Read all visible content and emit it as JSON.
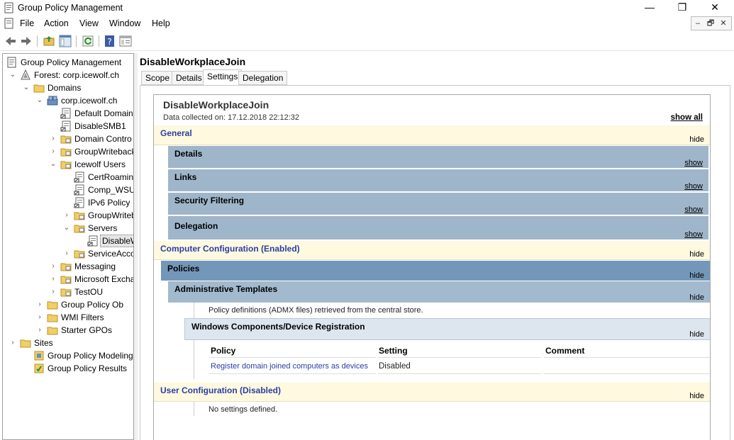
{
  "window": {
    "title": "Group Policy Management",
    "minimize": "—",
    "maximize": "❐",
    "close": "✕"
  },
  "menu": [
    "File",
    "Action",
    "View",
    "Window",
    "Help"
  ],
  "mdi_buttons": [
    "–",
    "🗗",
    "✕"
  ],
  "tree": [
    {
      "label": "Group Policy Management",
      "expander": "",
      "icon": "gpm-icon"
    },
    {
      "label": "Forest: corp.icewolf.ch",
      "expander": "⌄",
      "icon": "forest-icon"
    },
    {
      "label": "Domains",
      "expander": "⌄",
      "icon": "folder-icon"
    },
    {
      "label": "corp.icewolf.ch",
      "expander": "⌄",
      "icon": "domain-icon"
    },
    {
      "label": "Default Domain",
      "expander": "",
      "icon": "gpo-link-icon"
    },
    {
      "label": "DisableSMB1",
      "expander": "",
      "icon": "gpo-link-icon"
    },
    {
      "label": "Domain Contro",
      "expander": "›",
      "icon": "ou-icon"
    },
    {
      "label": "GroupWriteback",
      "expander": "›",
      "icon": "ou-icon"
    },
    {
      "label": "Icewolf Users",
      "expander": "⌄",
      "icon": "ou-icon"
    },
    {
      "label": "CertRoamin",
      "expander": "",
      "icon": "gpo-link-icon"
    },
    {
      "label": "Comp_WSU",
      "expander": "",
      "icon": "gpo-link-icon"
    },
    {
      "label": "IPv6 Policy",
      "expander": "",
      "icon": "gpo-link-icon"
    },
    {
      "label": "GroupWriteb",
      "expander": "›",
      "icon": "ou-icon"
    },
    {
      "label": "Servers",
      "expander": "⌄",
      "icon": "ou-icon"
    },
    {
      "label": "DisableW",
      "expander": "",
      "icon": "gpo-link-icon"
    },
    {
      "label": "ServiceAcco",
      "expander": "›",
      "icon": "ou-icon"
    },
    {
      "label": "Messaging",
      "expander": "›",
      "icon": "ou-icon"
    },
    {
      "label": "Microsoft Excha",
      "expander": "›",
      "icon": "ou-icon"
    },
    {
      "label": "TestOU",
      "expander": "›",
      "icon": "ou-icon"
    },
    {
      "label": "Group Policy Ob",
      "expander": "›",
      "icon": "folder-icon"
    },
    {
      "label": "WMI Filters",
      "expander": "›",
      "icon": "folder-icon"
    },
    {
      "label": "Starter GPOs",
      "expander": "›",
      "icon": "folder-icon"
    },
    {
      "label": "Sites",
      "expander": "›",
      "icon": "folder-icon"
    },
    {
      "label": "Group Policy Modeling",
      "expander": "",
      "icon": "modeling-icon"
    },
    {
      "label": "Group Policy Results",
      "expander": "",
      "icon": "results-icon"
    }
  ],
  "right": {
    "title": "DisableWorkplaceJoin",
    "tabs": [
      "Scope",
      "Details",
      "Settings",
      "Delegation"
    ],
    "active_tab": "Settings"
  },
  "report": {
    "title": "DisableWorkplaceJoin",
    "collected": "Data collected on: 17.12.2018 22:12:32",
    "show_all": "show all",
    "general": {
      "title": "General",
      "link": "hide"
    },
    "details": {
      "title": "Details",
      "link": "show"
    },
    "links": {
      "title": "Links",
      "link": "show"
    },
    "security": {
      "title": "Security Filtering",
      "link": "show"
    },
    "delegation": {
      "title": "Delegation",
      "link": "show"
    },
    "computer": {
      "title": "Computer Configuration (Enabled)",
      "link": "hide"
    },
    "policies": {
      "title": "Policies",
      "link": "hide"
    },
    "admin_templates": {
      "title": "Administrative Templates",
      "link": "hide"
    },
    "admx_note": "Policy definitions (ADMX files) retrieved from the central store.",
    "wcdr": {
      "title": "Windows Components/Device Registration",
      "link": "hide"
    },
    "table": {
      "headers": [
        "Policy",
        "Setting",
        "Comment"
      ],
      "rows": [
        {
          "policy": "Register domain joined computers as devices",
          "setting": "Disabled",
          "comment": ""
        }
      ]
    },
    "user": {
      "title": "User Configuration (Disabled)",
      "link": "hide"
    },
    "no_settings": "No settings defined."
  },
  "colors": {
    "accent_blue": "#2b3ea5",
    "section_bg": "#fef9df",
    "group_bg": "#9fb5ca"
  }
}
